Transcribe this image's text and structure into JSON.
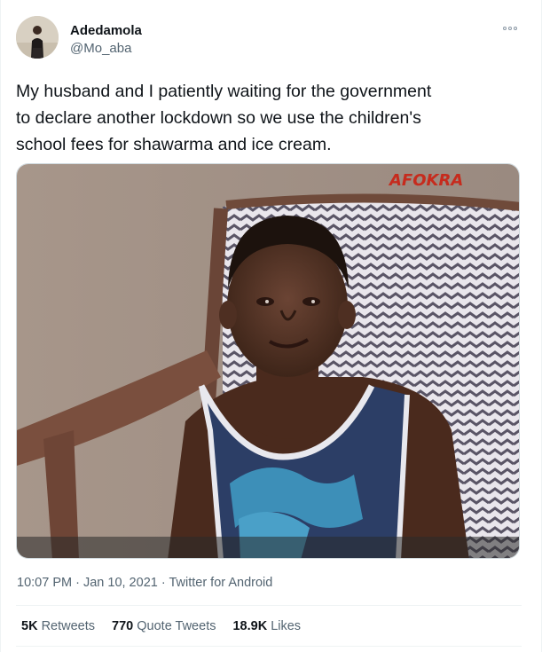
{
  "author": {
    "display_name": "Adedamola",
    "handle": "@Mo_aba",
    "avatar_icon": "user-photo"
  },
  "tweet": {
    "lines": [
      "My husband and I patiently waiting for the government",
      "to declare another lockdown so we use the children's",
      "school fees for shawarma and ice cream."
    ],
    "media_watermark": "AFOKRA"
  },
  "meta": {
    "time": "10:07 PM",
    "sep1": " · ",
    "date": "Jan 10, 2021",
    "sep2": " · ",
    "source": "Twitter for Android"
  },
  "stats": {
    "retweets_count": "5K",
    "retweets_label": "Retweets",
    "quotes_count": "770",
    "quotes_label": "Quote Tweets",
    "likes_count": "18.9K",
    "likes_label": "Likes"
  },
  "colors": {
    "text_primary": "#0f1419",
    "text_secondary": "#536471",
    "divider": "#eff3f4"
  }
}
